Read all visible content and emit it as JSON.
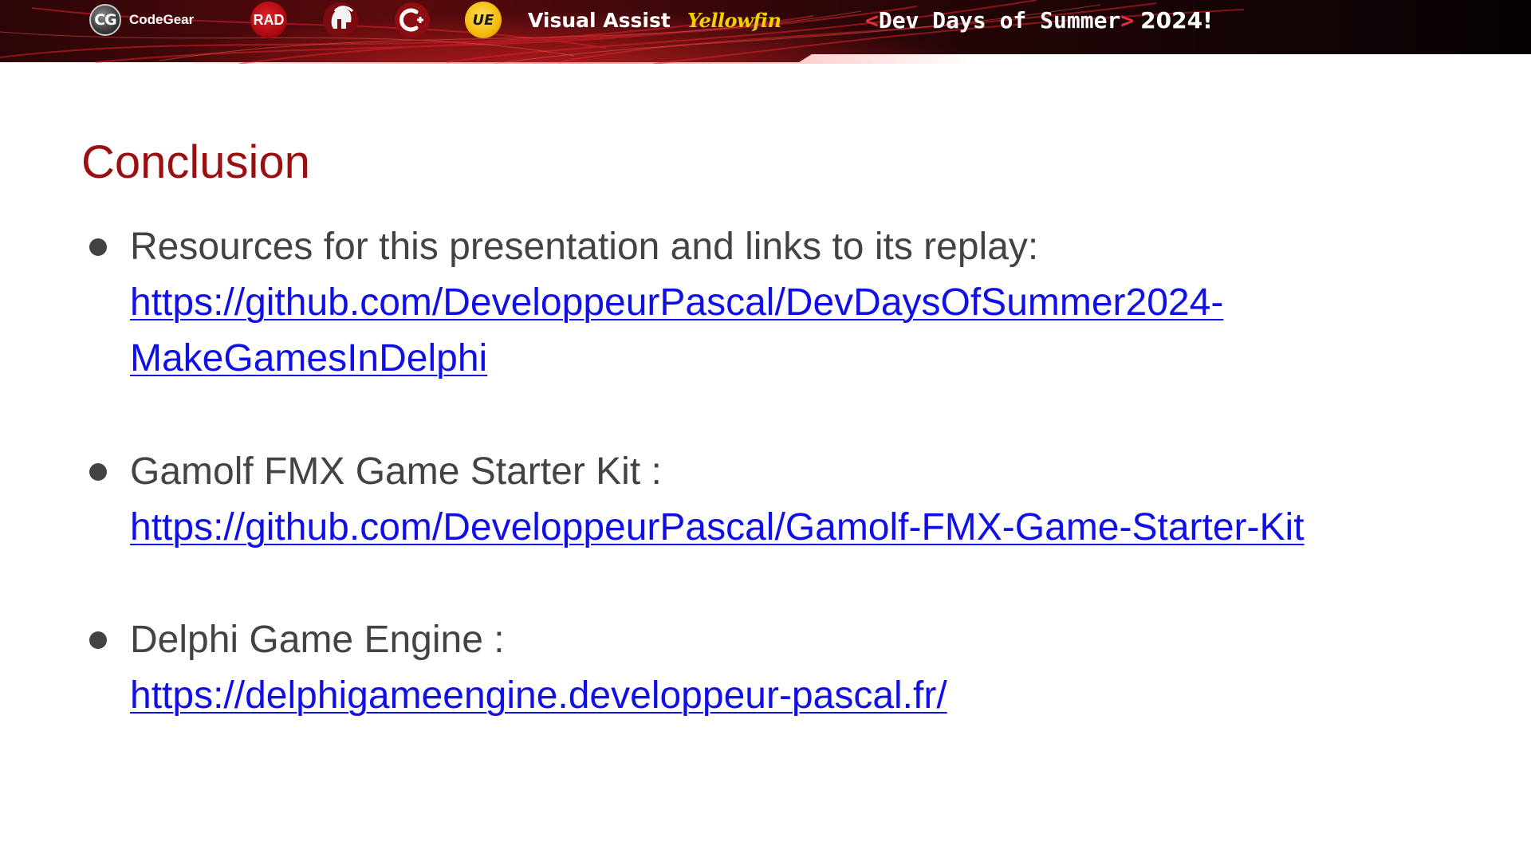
{
  "banner": {
    "logos": {
      "codegear_badge": "CG",
      "codegear_text": "CodeGear",
      "rad_badge": "RAD",
      "spartan_icon": "spartan-helmet-icon",
      "cpp_icon": "cpp-builder-icon",
      "ue_badge": "UE",
      "visual_assist": "Visual Assist",
      "yellowfin": "Yellowfin"
    },
    "event": {
      "open_bracket": "<",
      "name": "Dev Days of Summer",
      "close_bracket": ">",
      "year": "2024!"
    },
    "colors": {
      "background": "#0d0506",
      "accent_red": "#d3141e",
      "bracket_red": "#e0303a"
    }
  },
  "slide": {
    "title": "Conclusion",
    "title_color": "#9a0f0f",
    "text_color": "#434343",
    "link_color": "#1010e6",
    "bullets": [
      {
        "label": "Resources for this presentation and links to its replay:",
        "link": "https://github.com/DeveloppeurPascal/DevDaysOfSummer2024-MakeGamesInDelphi"
      },
      {
        "label": "Gamolf FMX Game Starter Kit :",
        "link": "https://github.com/DeveloppeurPascal/Gamolf-FMX-Game-Starter-Kit"
      },
      {
        "label": "Delphi Game Engine :",
        "link": "https://delphigameengine.developpeur-pascal.fr/"
      }
    ]
  }
}
